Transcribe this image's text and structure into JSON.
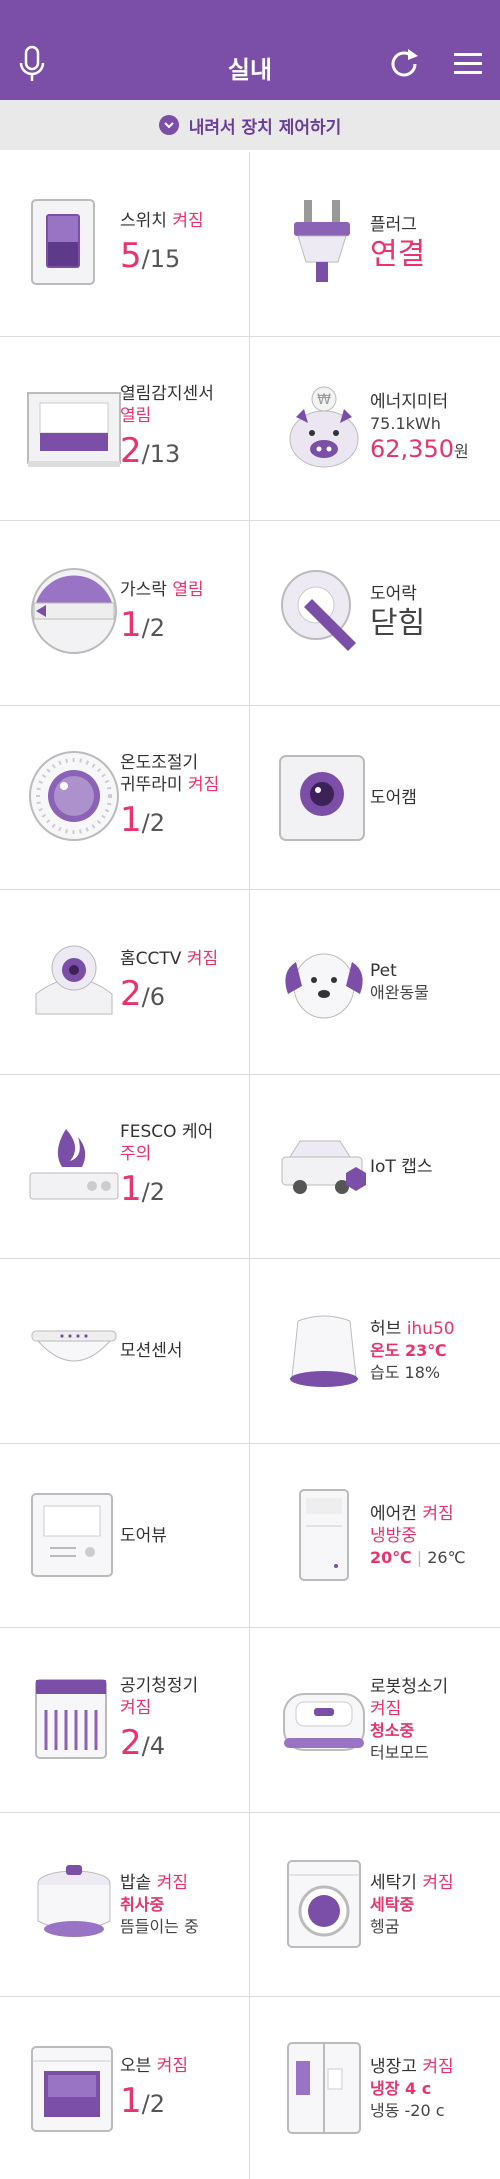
{
  "header": {
    "title": "실내"
  },
  "subbar": {
    "label": "내려서 장치 제어하기"
  },
  "colors": {
    "brand": "#7b4fa8",
    "status": "#e8336d"
  },
  "devices": {
    "switch": {
      "name": "스위치",
      "status": "켜짐",
      "count": "5",
      "total": "/15"
    },
    "plug": {
      "name": "플러그",
      "status": "연결"
    },
    "open_sensor": {
      "name": "열림감지센서",
      "status": "열림",
      "count": "2",
      "total": "/13"
    },
    "energy": {
      "name": "에너지미터",
      "kwh": "75.1kWh",
      "amount": "62,350",
      "unit": "원"
    },
    "gas_lock": {
      "name": "가스락",
      "status": "열림",
      "count": "1",
      "total": "/2"
    },
    "door_lock": {
      "name": "도어락",
      "status": "닫힘"
    },
    "thermostat": {
      "name": "온도조절기",
      "brand": "귀뚜라미",
      "status": "켜짐",
      "count": "1",
      "total": "/2"
    },
    "door_cam": {
      "name": "도어캠"
    },
    "home_cctv": {
      "name": "홈CCTV",
      "status": "켜짐",
      "count": "2",
      "total": "/6"
    },
    "pet": {
      "name": "Pet",
      "sub": "애완동물"
    },
    "fesco": {
      "name": "FESCO 케어",
      "status": "주의",
      "count": "1",
      "total": "/2"
    },
    "iot_caps": {
      "name": "IoT 캡스"
    },
    "motion": {
      "name": "모션센서"
    },
    "hub": {
      "name": "허브",
      "model": "ihu50",
      "temp": "온도 23℃",
      "humidity": "습도 18%"
    },
    "door_view": {
      "name": "도어뷰"
    },
    "aircon": {
      "name": "에어컨",
      "status": "켜짐",
      "mode": "냉방중",
      "set_temp": "20℃",
      "sep": "|",
      "cur_temp": "26℃"
    },
    "air_purifier": {
      "name": "공기청정기",
      "status": "켜짐",
      "count": "2",
      "total": "/4"
    },
    "robot_vacuum": {
      "name": "로봇청소기",
      "status": "켜짐",
      "mode": "청소중",
      "sub": "터보모드"
    },
    "rice_cooker": {
      "name": "밥솥",
      "status": "켜짐",
      "mode": "취사중",
      "sub": "뜸들이는 중"
    },
    "washer": {
      "name": "세탁기",
      "status": "켜짐",
      "mode": "세탁중",
      "sub": "헹굼"
    },
    "oven": {
      "name": "오븐",
      "status": "켜짐",
      "count": "1",
      "total": "/2"
    },
    "fridge": {
      "name": "냉장고",
      "status": "켜짐",
      "fridge_temp": "냉장 4 c",
      "freezer_temp": "냉동 -20 c"
    }
  },
  "icons": [
    "mic-icon",
    "refresh-icon",
    "menu-icon",
    "chevron-down-icon"
  ]
}
